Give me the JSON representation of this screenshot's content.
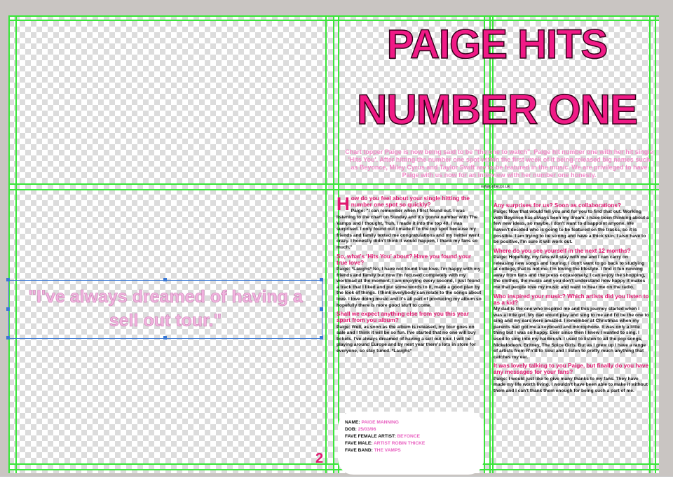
{
  "page": {
    "number": "2"
  },
  "title": {
    "line1": "PAIGE HITS",
    "line2": "NUMBER ONE"
  },
  "intro": "Chart topper Paige is now being said to be \"the one to watch\". Paige hit number one with her hit single 'Hits You'. After hitting the number one spot within the first week of it being released big names such as Beyonce, Miley Cyrus and Taylor Swift are to be featured in the music. We are privileged to have Paige with us now for an interview with her number one honesty.",
  "folio": "www.vibe.co.uk",
  "pull_quote": "\"I've always dreamed of having a sell out tour.\"",
  "interview": {
    "dropcap": "H",
    "left_column": [
      {
        "type": "q",
        "text": "ow do you feel about your single hitting the number one spot so quickly?"
      },
      {
        "type": "a",
        "text": "Paige: \"I can remember when I first found out. I was listening to the chart on Sunday and it's gonna number with The Vamps and I thought, 'huh, I made it into the top 40. I was surprised. I only found out I made it to the top spot because my friends and family texted me congratulations and my twitter went crazy. I honestly didn't think it would happen, I thank my fans so much.\""
      },
      {
        "type": "q",
        "text": "So, what's 'Hits You' about? Have you found your true love?"
      },
      {
        "type": "a",
        "text": "Paige: *Laughs* No, I have not found true love. I'm happy with my friends and family but now I'm focused completely with my workload at the moment. I am enjoying every second, I just found a track that I liked and put some words to it, made a good plan by the look of things. I think everybody can relate to the songs about love. I love doing music and it's all part of producing my album so hopefully there is more good stuff to come."
      },
      {
        "type": "q",
        "text": "Shall we expect anything else from you this year apart from you album?"
      },
      {
        "type": "a",
        "text": "Paige: Well, as soon as the album is released, my tour goes on sale and I think it will be so fun. I've started that no one will buy tickets. I've always dreamed of having a sell out tour. I will be playing around Europe and by next year there's lots in store for everyone, so stay tuned. *Laughs*"
      }
    ],
    "right_column": [
      {
        "type": "q",
        "text": "Any surprises for us? Soon as collaborations?"
      },
      {
        "type": "a",
        "text": "Paige: Now that would tell you and for you to find that out. Working with Beyonce has always been my dream. I have been thinking about a few new ideas, so maybe. I don't want to disappoint anyone. We haven't decided who is going to be featured on the tracks, so it is possible. I am trying to be strong and have a thick skin. I also have to be positive, I'm sure it will work out."
      },
      {
        "type": "q",
        "text": "Where do you see yourself in the next 12 months?"
      },
      {
        "type": "a",
        "text": "Paige: Hopefully, my fans will stay with me and I can carry on releasing new songs and touring. I don't want to go back to studying at college, that is not me. I'm loving the lifestyle. I find it fun running away from fans and the press occasionally, I can enjoy the shopping, the clothes, the music and you don't understand how happy it makes me that people love my music and want to hear me on the radio."
      },
      {
        "type": "q",
        "text": "Who inspired your music? Which artists did you listen to as a kid?"
      },
      {
        "type": "a",
        "text": "My dad is the one who inspired me and this journey started when I was a little girl. My dad would play and sing to me and I'd be the one to sing and my ears were amazed. I remember at Christmas when my parents had got me a keyboard and microphone. It was only a little thing but I was so happy. Ever since then I knew I wanted to sing. I used to sing into my hairbrush. I used to listen to all the pop songs, Nickelodeon, Britney, The Spice Girls. But as I grew up I have a range of artists from R'n'B to Soul and I listen to pretty much anything that catches my ear."
      },
      {
        "type": "q",
        "text": "It was lovely talking to you Paige, but finally do you have any messages for your fans?"
      },
      {
        "type": "a",
        "text": "Paige: I would just like to give many thanks to my fans. They have made my life worth living. I wouldn't have been able to make it without them and I can't thank them enough for being such a part of me."
      }
    ]
  },
  "fact_file": [
    {
      "label": "NAME:",
      "value": "PAIGE MANNING"
    },
    {
      "label": "DOB:",
      "value": "25/03/96"
    },
    {
      "label": "FAVE FEMALE ARTIST:",
      "value": "BEYONCE"
    },
    {
      "label": "FAVE MALE:",
      "value": "ARTIST ROBIN THICKE"
    },
    {
      "label": "FAVE BAND:",
      "value": "THE VAMPS"
    }
  ],
  "colors": {
    "accent_pink": "#e0186f",
    "title_pink": "#f01a86",
    "guide_green": "#39e639",
    "selection_blue": "#3a78d4"
  }
}
